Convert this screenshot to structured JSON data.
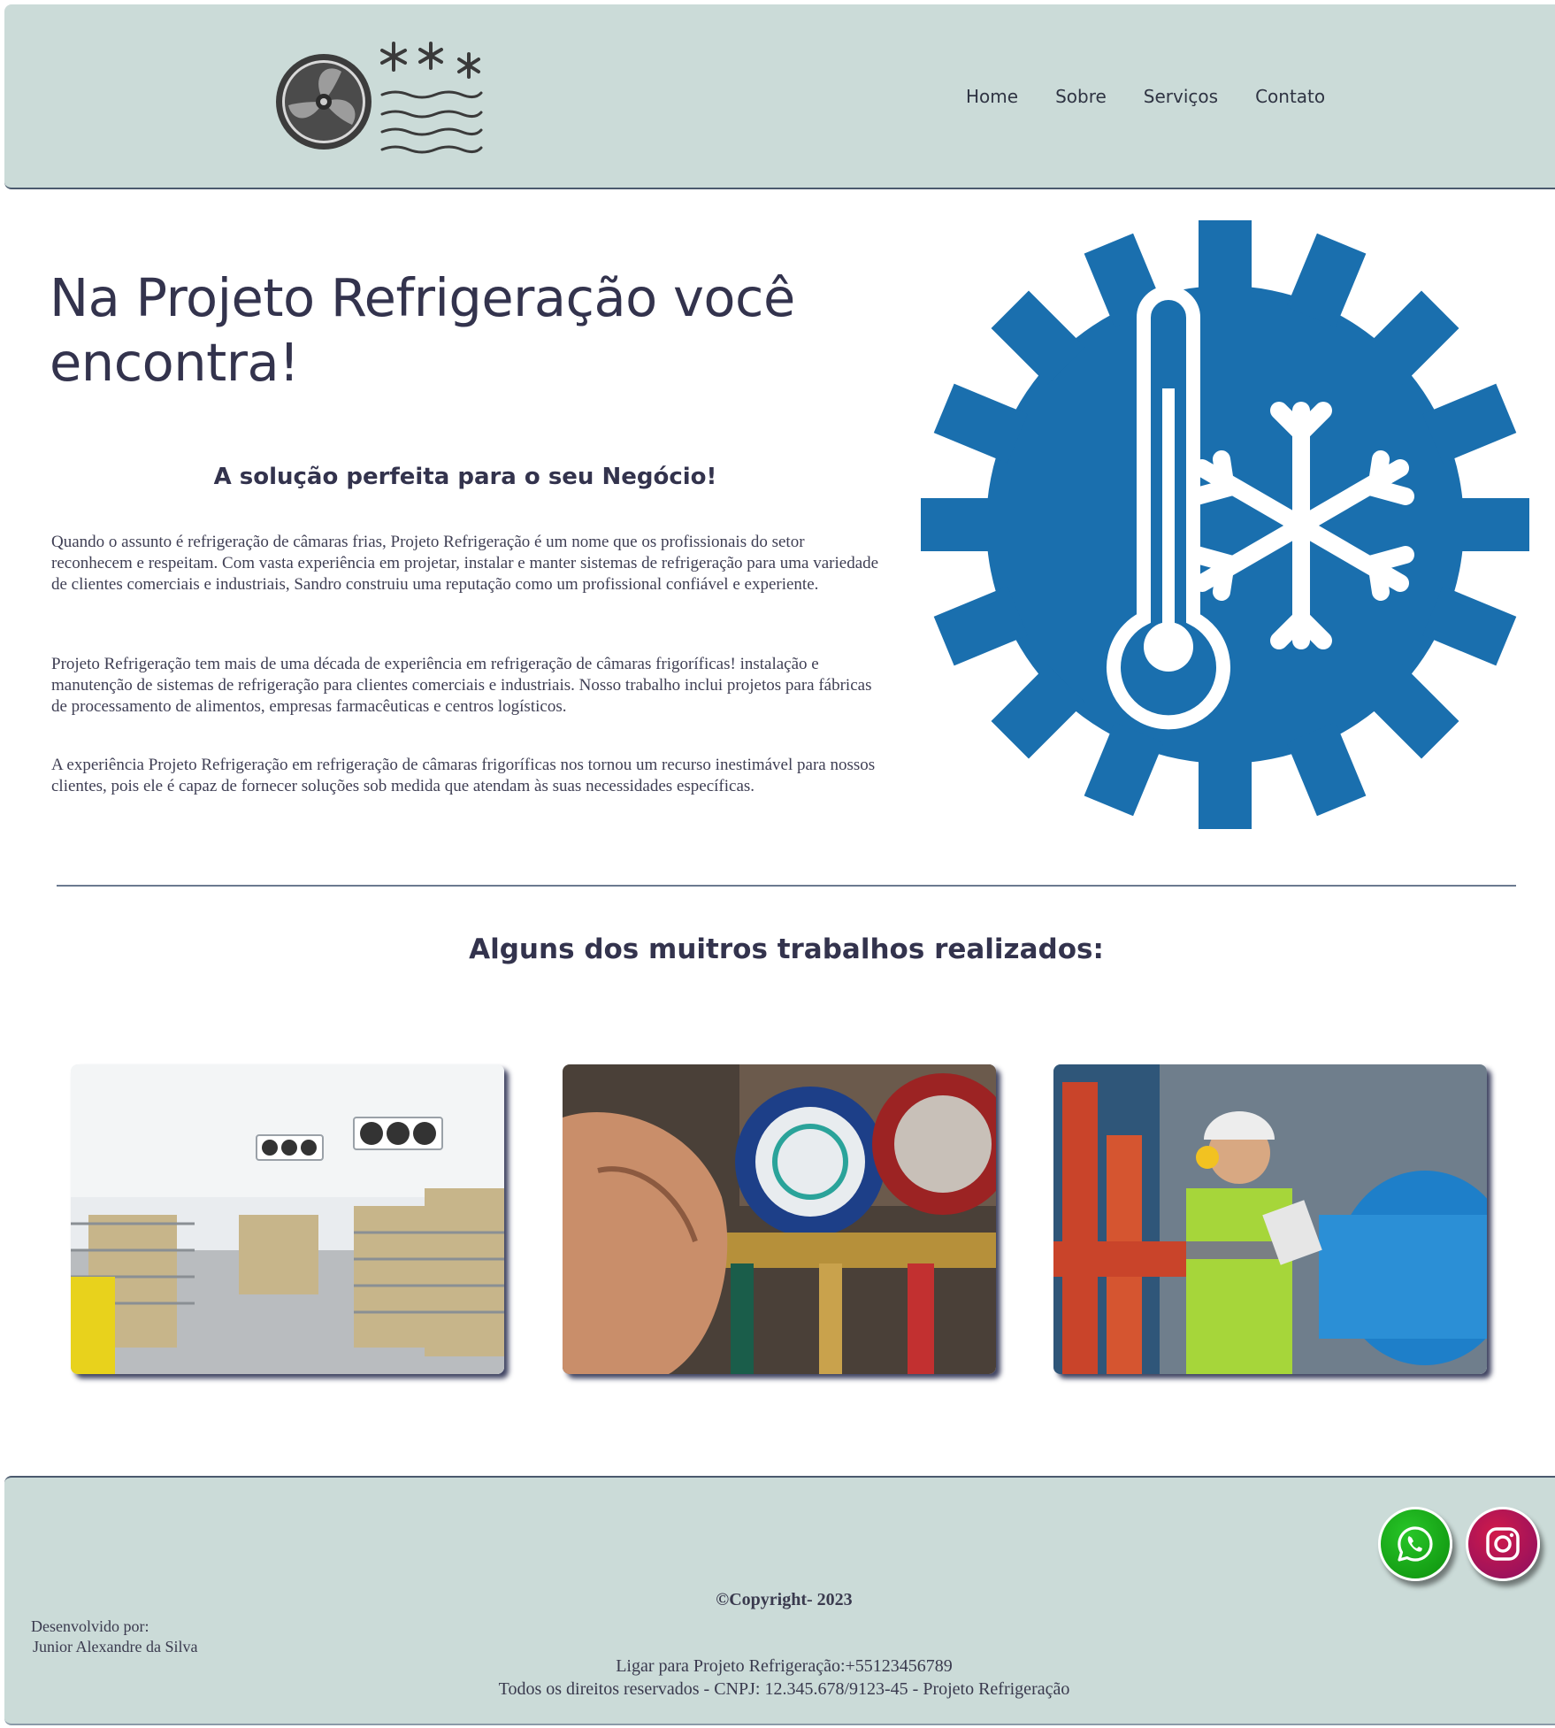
{
  "header": {
    "nav": [
      "Home",
      "Sobre",
      "Serviços",
      "Contato"
    ]
  },
  "hero": {
    "title": "Na Projeto Refrigeração você encontra!",
    "subtitle": "A solução perfeita para o seu Negócio!",
    "paragraphs": [
      "Quando o assunto é refrigeração de câmaras frias, Projeto Refrigeração é um nome que os profissionais do setor reconhecem e respeitam. Com vasta experiência em projetar, instalar e manter sistemas de refrigeração para uma variedade de clientes comerciais e industriais, Sandro construiu uma reputação como um profissional confiável e experiente.",
      "Projeto Refrigeração tem mais de uma década de experiência em refrigeração de câmaras frigoríficas! instalação e manutenção de sistemas de refrigeração para clientes comerciais e industriais. Nosso trabalho inclui projetos para fábricas de processamento de alimentos, empresas farmacêuticas e centros logísticos.",
      "A experiência Projeto Refrigeração em refrigeração de câmaras frigoríficas nos tornou um recurso inestimável para nossos clientes, pois ele é capaz de fornecer soluções sob medida que atendam às suas necessidades específicas."
    ],
    "image_icon": "gear-thermometer-snowflake-icon",
    "accent_color": "#1a6fae"
  },
  "works": {
    "heading": "Alguns dos muitros trabalhos realizados:",
    "images": [
      "cold-room-photo",
      "pressure-gauges-photo",
      "technician-photo"
    ]
  },
  "footer": {
    "copyright": "©Copyright- 2023",
    "developed_by_label": "Desenvolvido por:",
    "developer_name": "Junior Alexandre da Silva",
    "phone_line": "Ligar para Projeto Refrigeração:+55123456789",
    "rights_line": "Todos os direitos reservados - CNPJ: 12.345.678/9123-45 - Projeto Refrigeração",
    "social": [
      "whatsapp-icon",
      "instagram-icon"
    ],
    "background_color": "#cbdbd8"
  }
}
